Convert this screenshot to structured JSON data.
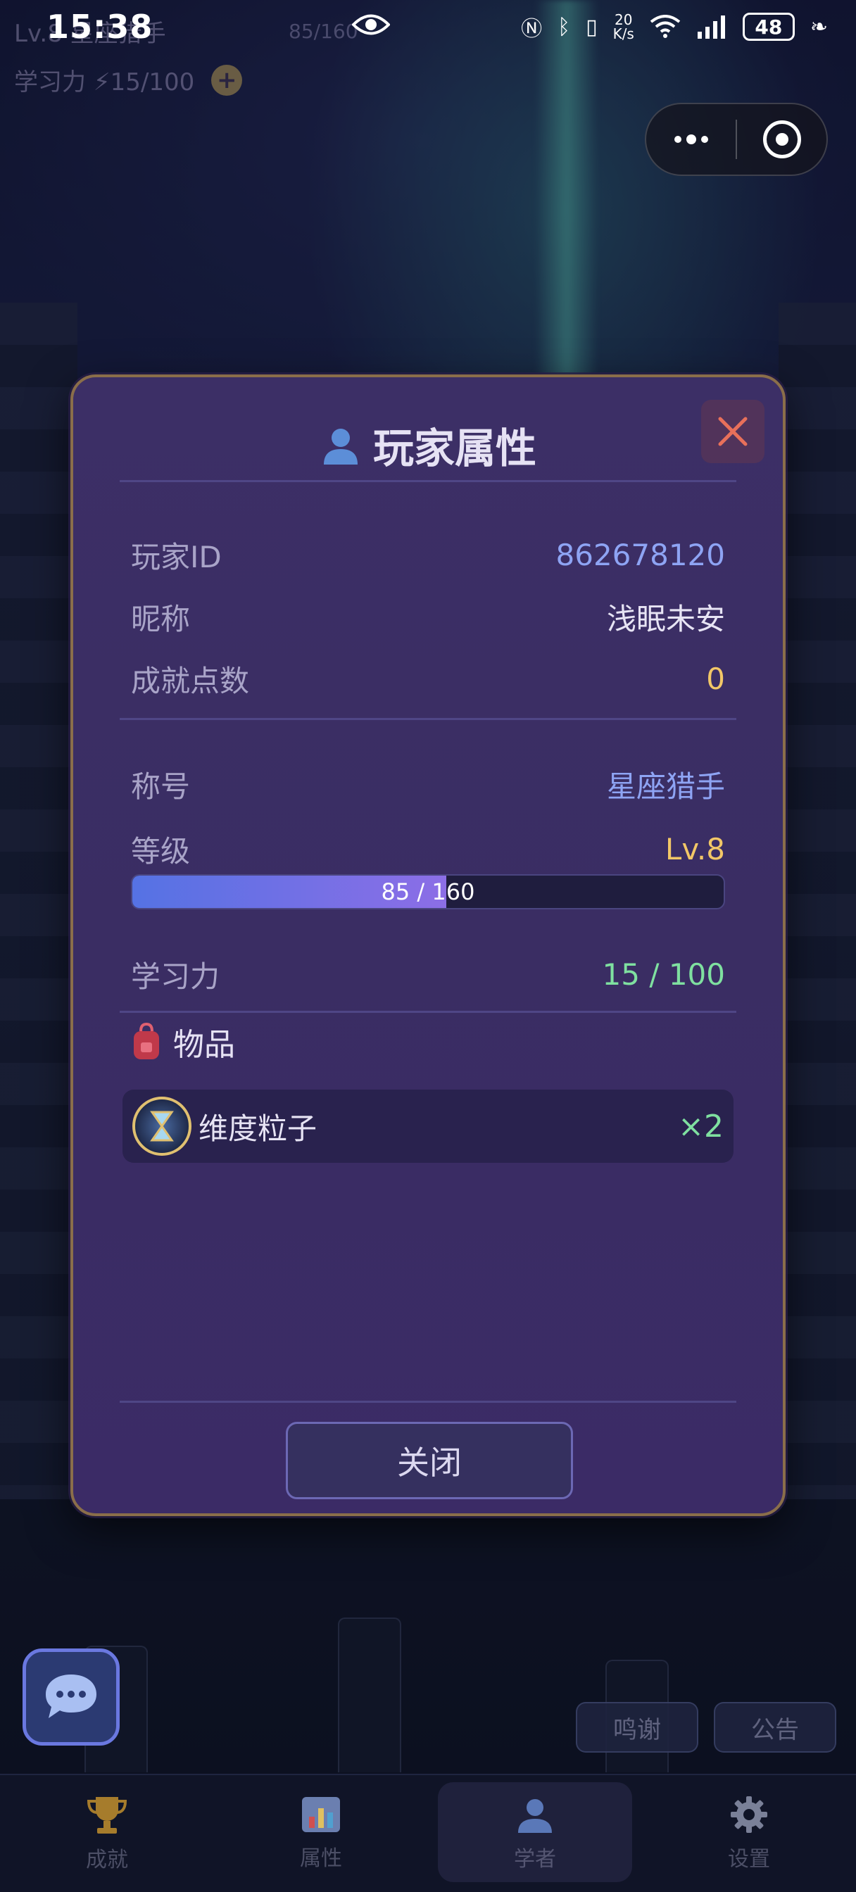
{
  "status_bar": {
    "time": "15:38",
    "net_speed_value": "20",
    "net_speed_unit": "K/s",
    "battery": "48"
  },
  "hud": {
    "level_name": "Lv.8  星座猎手",
    "xp": "85/160",
    "study_power": "学习力 ⚡15/100",
    "plus": "+"
  },
  "modal": {
    "title": "玩家属性",
    "rows": {
      "player_id_label": "玩家ID",
      "player_id_value": "862678120",
      "nickname_label": "昵称",
      "nickname_value": "浅眠未安",
      "achievement_label": "成就点数",
      "achievement_value": "0",
      "title_label": "称号",
      "title_value": "星座猎手",
      "level_label": "等级",
      "level_value": "Lv.8",
      "study_label": "学习力",
      "study_value": "15 / 100"
    },
    "xp": {
      "text": "85 / 160",
      "current": 85,
      "max": 160
    },
    "items_heading": "物品",
    "items": [
      {
        "name": "维度粒子",
        "count": "×2",
        "icon": "hourglass-icon"
      }
    ],
    "close_label": "关闭"
  },
  "background_buttons": {
    "thanks": "鸣谢",
    "notice": "公告"
  },
  "tabbar": [
    {
      "label": "成就",
      "icon": "trophy-icon"
    },
    {
      "label": "属性",
      "icon": "bar-chart-icon"
    },
    {
      "label": "学者",
      "icon": "person-icon",
      "active": true
    },
    {
      "label": "设置",
      "icon": "gear-icon"
    }
  ],
  "colors": {
    "modal_bg": "#3b2e65",
    "modal_border": "#8a6e4a",
    "accent_blue": "#8ea4f4",
    "accent_gold": "#f2c767",
    "accent_green": "#7fe0a0",
    "close_red": "#e8705a"
  }
}
